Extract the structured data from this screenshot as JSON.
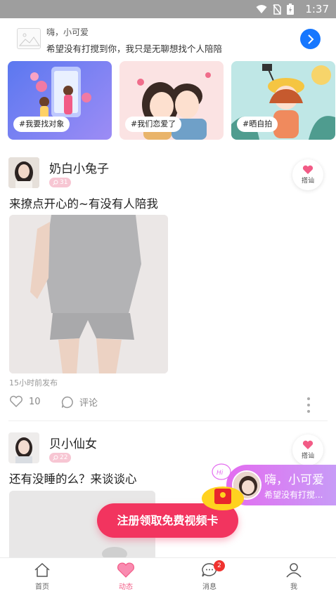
{
  "status_bar": {
    "time": "1:37"
  },
  "notice": {
    "title": "嗨，小可爱",
    "message": "希望没有打搅到你，我只是无聊想找个人陪陪",
    "accent": "#1677ff"
  },
  "topics": [
    {
      "tag": "#我要找对象"
    },
    {
      "tag": "#我们恋爱了"
    },
    {
      "tag": "#晒自拍"
    }
  ],
  "posts": [
    {
      "username": "奶白小兔子",
      "badge_count": "31",
      "hello_label": "搭讪",
      "text": "来撩点开心的~有没有人陪我",
      "time": "15小时前发布",
      "likes": "10",
      "comment_label": "评论"
    },
    {
      "username": "贝小仙女",
      "badge_count": "22",
      "hello_label": "搭讪",
      "text": "还有没睡的么？来谈谈心"
    }
  ],
  "float_chat": {
    "title": "嗨，小可爱",
    "message": "希望没有打搅..."
  },
  "cta": {
    "label": "注册领取免费视频卡",
    "color": "#f2345f"
  },
  "tabbar": {
    "items": [
      {
        "label": "首页",
        "icon": "home-icon"
      },
      {
        "label": "动态",
        "icon": "heart-icon",
        "active": true
      },
      {
        "label": "消息",
        "icon": "chat-icon",
        "badge": "2"
      },
      {
        "label": "我",
        "icon": "user-icon"
      }
    ],
    "active_color": "#f25b86"
  }
}
